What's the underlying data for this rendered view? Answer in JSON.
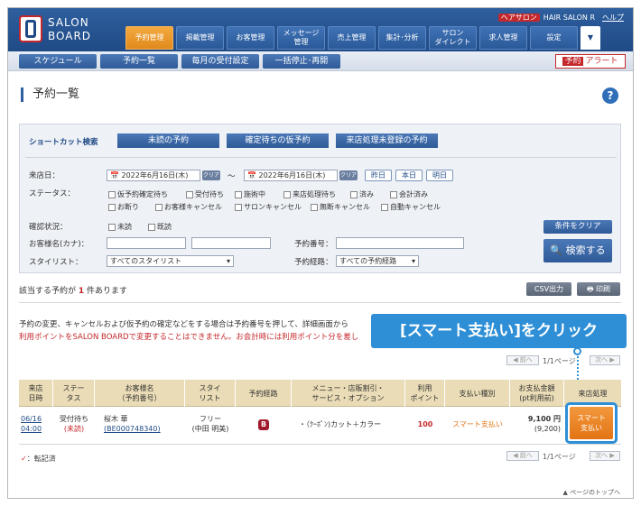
{
  "app": {
    "logo_line1": "SALON",
    "logo_line2": "BOARD",
    "help_tag": "ヘアサロン",
    "salon_name": "HAIR SALON R",
    "help_link": "ヘルプ"
  },
  "tabs": [
    {
      "label": "予約管理"
    },
    {
      "label": "掲載管理"
    },
    {
      "label": "お客管理"
    },
    {
      "label": "メッセージ\n管理"
    },
    {
      "label": "売上管理"
    },
    {
      "label": "集計･分析"
    },
    {
      "label": "サロン\nダイレクト"
    },
    {
      "label": "求人管理"
    },
    {
      "label": "設定"
    },
    {
      "label": "▼"
    }
  ],
  "subtabs": {
    "schedule": "スケジュール",
    "list": "予約一覧",
    "monthly": "毎月の受付設定",
    "bulk": "一括停止･再開"
  },
  "alert": {
    "tag": "予約",
    "label": "アラート"
  },
  "page": {
    "title": "予約一覧",
    "help_icon": "?"
  },
  "shortcut": {
    "label": "ショートカット検索",
    "b1": "未読の予約",
    "b2": "確定待ちの仮予約",
    "b3": "来店処理未登録の予約"
  },
  "filters": {
    "date_label": "来店日：",
    "date_from": "📅 2022年6月16日(木)",
    "clear": "クリア",
    "tilde": "～",
    "date_to": "📅 2022年6月16日(木)",
    "yesterday": "昨日",
    "today": "本日",
    "tomorrow": "明日",
    "status_label": "ステータス：",
    "status_opts": [
      "仮予約確定待ち",
      "受付待ち",
      "施術中",
      "来店処理待ち",
      "済み",
      "会計済み",
      "お断り",
      "お客様キャンセル",
      "サロンキャンセル",
      "無断キャンセル",
      "自動キャンセル"
    ],
    "confirm_label": "確認状況：",
    "confirm_opts": [
      "未読",
      "既読"
    ],
    "name_label": "お客様名(カナ)：",
    "resv_no_label": "予約番号：",
    "stylist_label": "スタイリスト：",
    "stylist_value": "すべてのスタイリスト",
    "route_label": "予約経路：",
    "route_value": "すべての予約経路",
    "clear_conditions": "条件をクリア",
    "search": "検索する"
  },
  "results": {
    "count_prefix": "該当する予約が",
    "count": "1",
    "count_suffix": "件あります",
    "csv": "CSV出力",
    "print": "印刷"
  },
  "note": {
    "line1": "予約の変更、キャンセルおよび仮予約の確定などをする場合は予約番号を押して、詳細画面から",
    "line2": "利用ポイントをSALON BOARDで変更することはできません。お会計時には利用ポイント分を差し"
  },
  "callout": "[スマート支払い]をクリック",
  "pager": {
    "prev": "◀ 前へ",
    "info": "1/1ページ",
    "next": "次へ ▶"
  },
  "table": {
    "headers": [
      "来店\n日時",
      "ステー\nタス",
      "お客様名\n（予約番号）",
      "スタイ\nリスト",
      "予約経路",
      "メニュー・店販割引・\nサービス・オプション",
      "利用\nポイント",
      "支払い種別",
      "お支払金額\n(pt利用前)",
      "来店処理"
    ],
    "row": {
      "date": "06/16",
      "time": "04:00",
      "status": "受付待ち",
      "status2": "(未読)",
      "name": "桜木 華",
      "resv_no": "(BE000748340)",
      "stylist": "フリー",
      "stylist2": "(中田 明美)",
      "route": "B",
      "menu": "・（ｸｰﾎﾟﾝ)カット＋カラー",
      "points": "100",
      "pay_type": "スマート支払い",
      "amount": "9,100 円",
      "amount2": "(9,200)",
      "action": "スマート\n支払い"
    }
  },
  "legend": {
    "mark": "✓",
    "text": "：転記済"
  },
  "footer": {
    "pagetop": "▲ ページのトップへ"
  }
}
